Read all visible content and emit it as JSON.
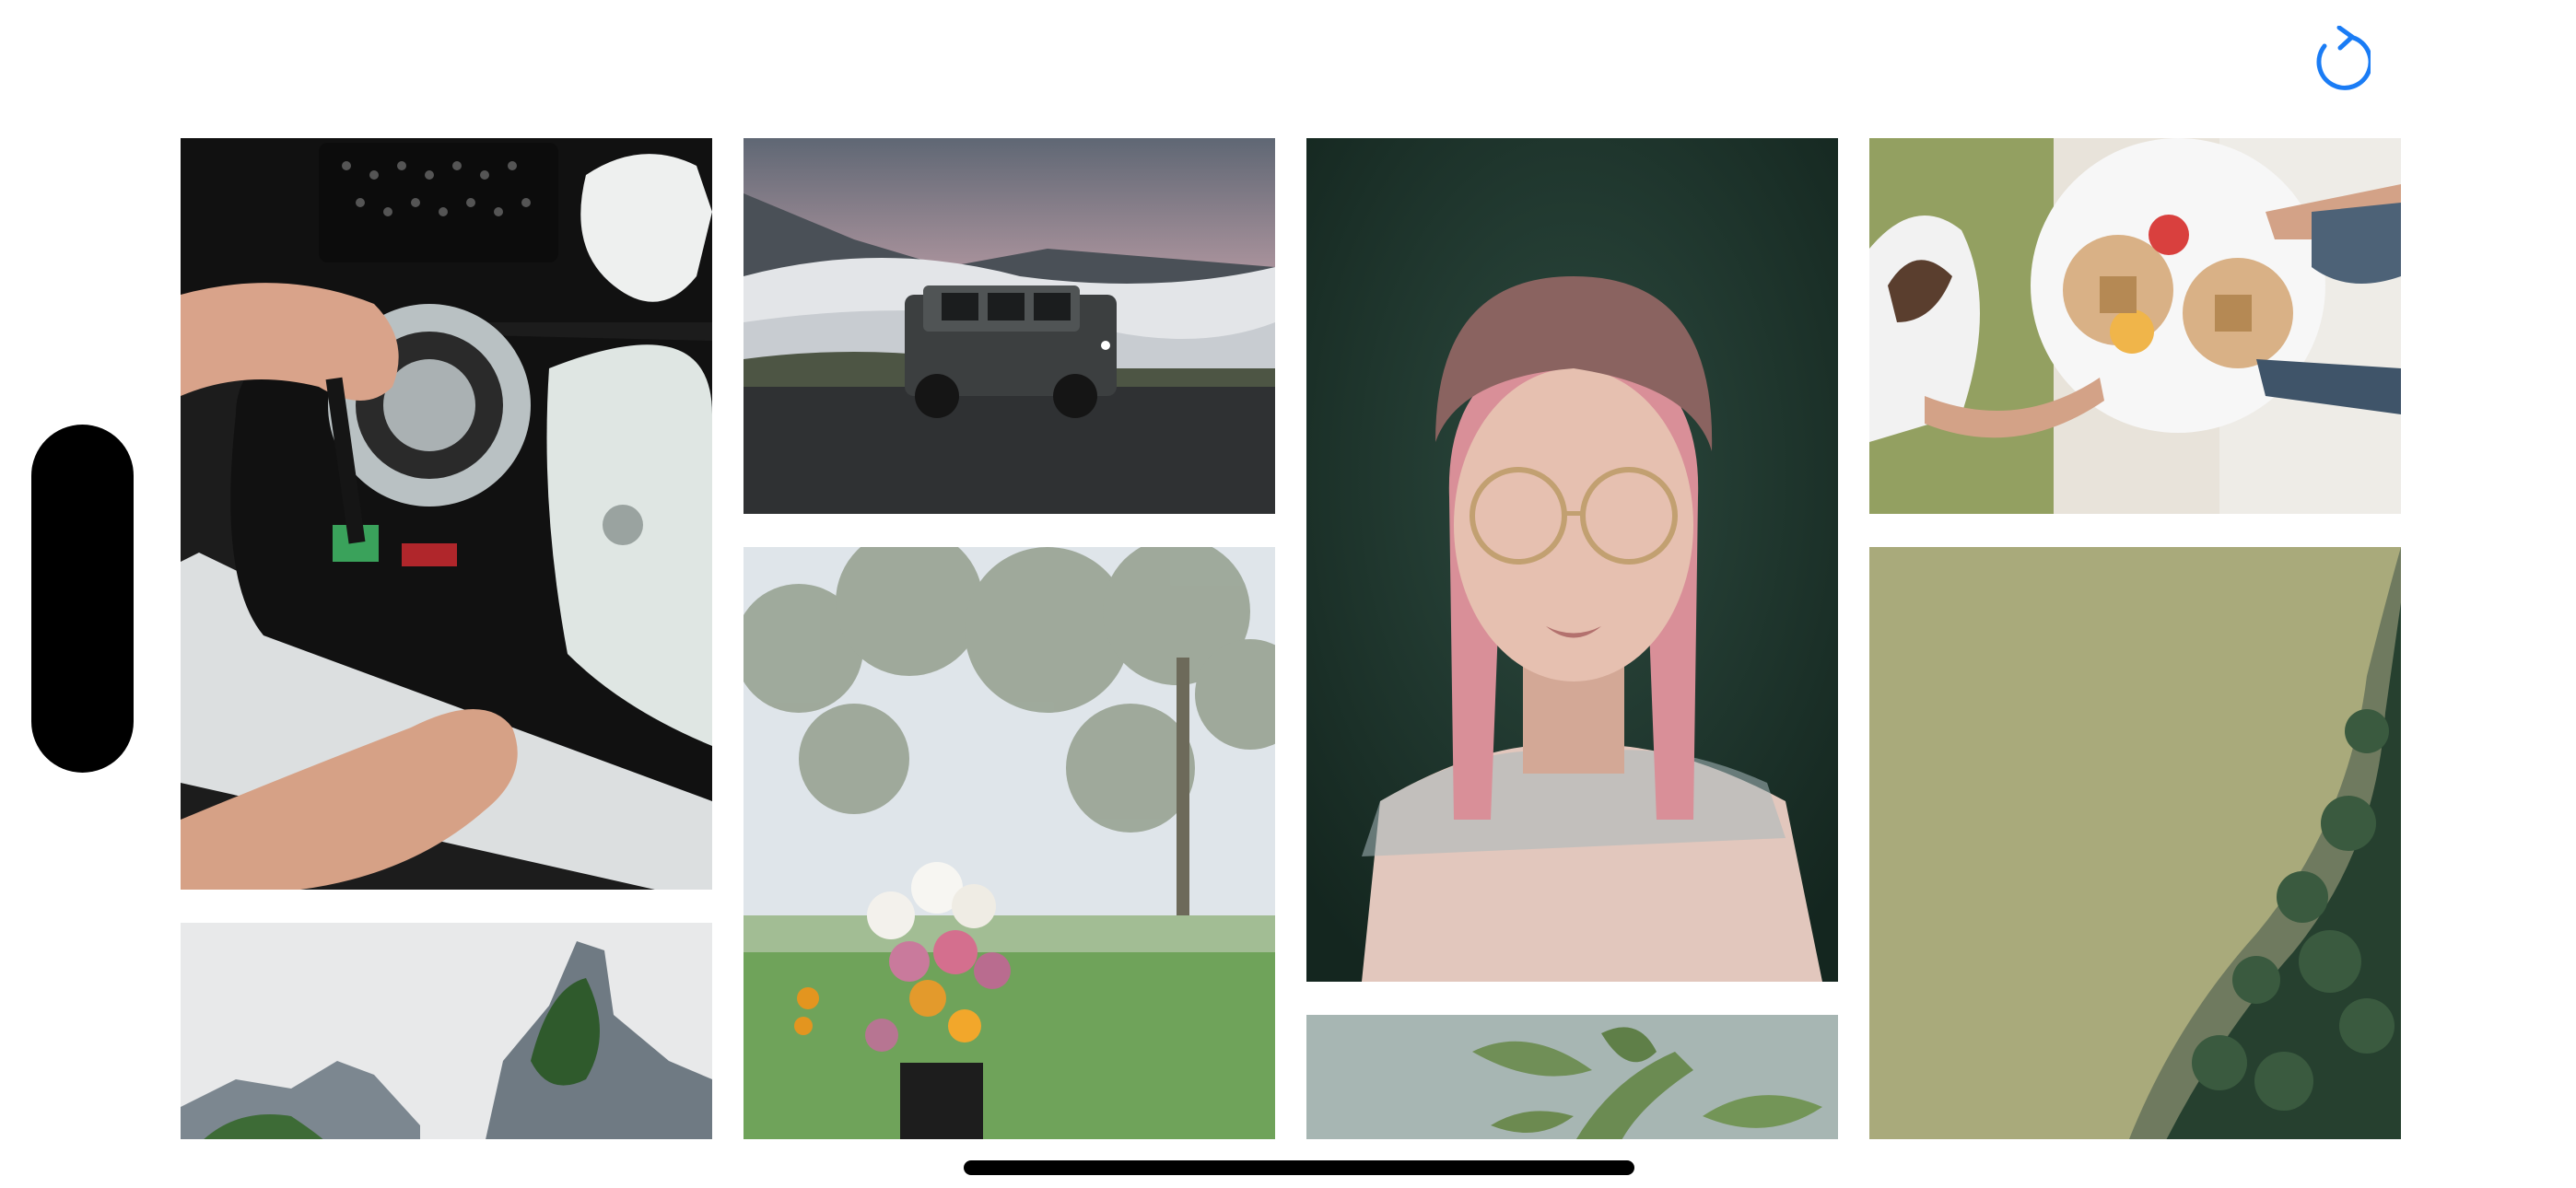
{
  "toolbar": {
    "refresh_icon": "arrow-clockwise-icon",
    "accent_color": "#1a7cf5"
  },
  "gallery": {
    "photos": [
      {
        "subject": "console-repair",
        "palette": [
          "#1e1e1e",
          "#d9dfdc"
        ]
      },
      {
        "subject": "suv-in-mountains",
        "palette": [
          "#6f7683",
          "#c9a7ae"
        ]
      },
      {
        "subject": "woman-with-glasses",
        "palette": [
          "#1f3a30",
          "#e2c7bd"
        ]
      },
      {
        "subject": "table-with-food",
        "palette": [
          "#f2f2f2",
          "#8da05c"
        ]
      },
      {
        "subject": "rock-peaks",
        "palette": [
          "#e6e6e6",
          "#707a82"
        ]
      },
      {
        "subject": "flower-bouquet",
        "palette": [
          "#dfe6eb",
          "#6ea458"
        ]
      },
      {
        "subject": "green-leaves",
        "palette": [
          "#b4c2bf",
          "#6c8a52"
        ]
      },
      {
        "subject": "aerial-coast",
        "palette": [
          "#a9ab7a",
          "#233a2c"
        ]
      }
    ]
  },
  "system": {
    "home_indicator_color": "#000000"
  }
}
